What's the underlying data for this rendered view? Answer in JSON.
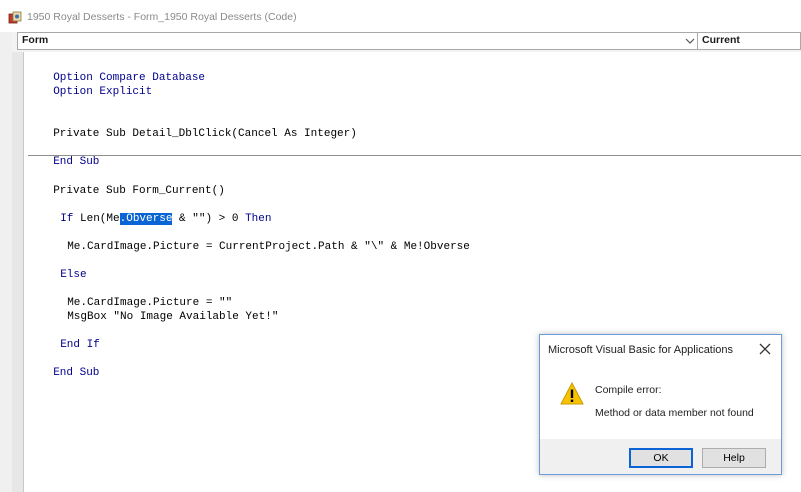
{
  "window": {
    "title": "1950 Royal Desserts - Form_1950 Royal Desserts (Code)"
  },
  "object_combo": {
    "value": "Form"
  },
  "procedure_combo": {
    "value": "Current"
  },
  "code": {
    "lines": [
      "Option Compare Database",
      "Option Explicit",
      "Private Sub Detail_DblClick(Cancel As Integer)",
      "End Sub",
      "Private Sub Form_Current()",
      "If Len(Me.Obverse & \"\") > 0 Then",
      "Me.CardImage.Picture = CurrentProject.Path & \"\\\" & Me!Obverse",
      "Else",
      "Me.CardImage.Picture = \"\"",
      "MsgBox \"No Image Available Yet!\"",
      "End If",
      "End Sub"
    ],
    "selected_text": ".Obverse"
  },
  "dialog": {
    "title": "Microsoft Visual Basic for Applications",
    "message_line1": "Compile error:",
    "message_line2": "Method or data member not found",
    "ok_label": "OK",
    "help_label": "Help",
    "icon": "warning-icon"
  },
  "colors": {
    "keyword": "#00008b",
    "selection": "#0a64d6"
  }
}
